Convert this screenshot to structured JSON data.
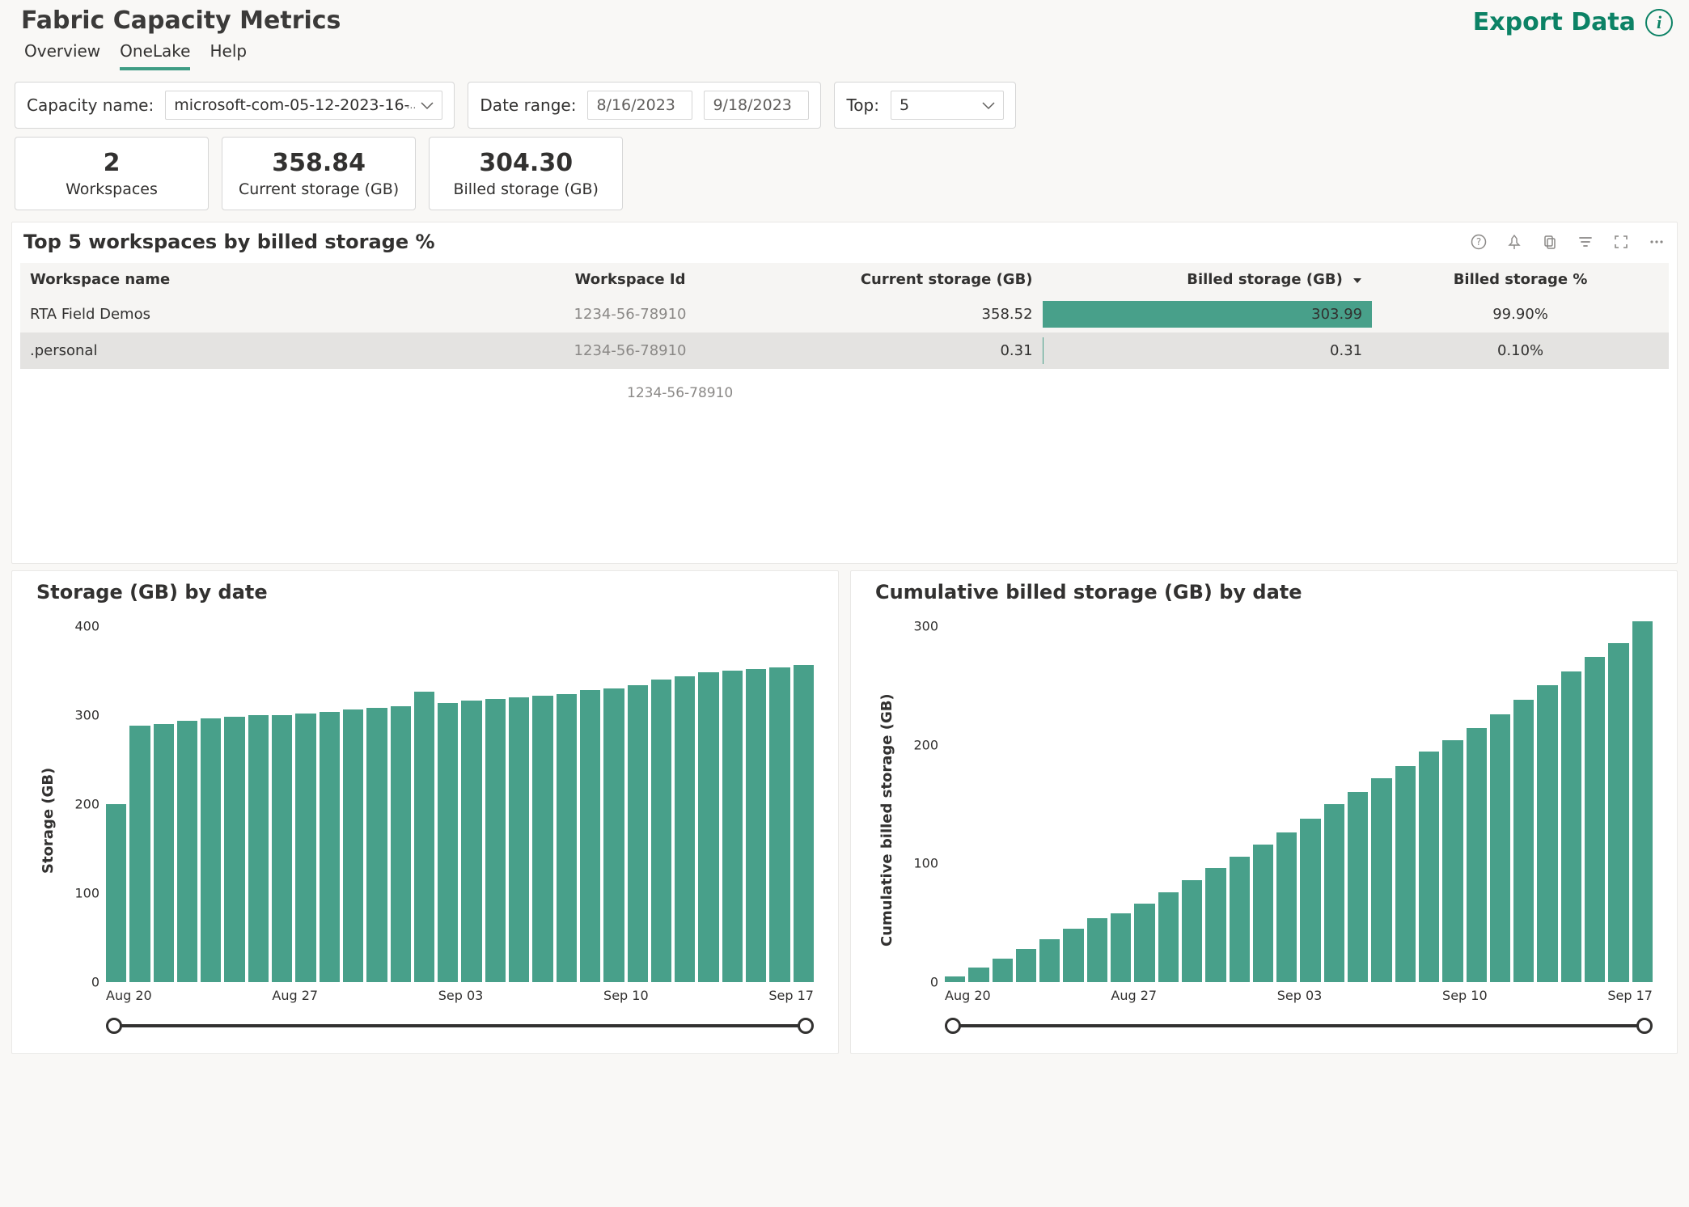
{
  "header": {
    "title": "Fabric Capacity Metrics",
    "tabs": [
      {
        "label": "Overview",
        "active": false
      },
      {
        "label": "OneLake",
        "active": true
      },
      {
        "label": "Help",
        "active": false
      }
    ],
    "export_label": "Export Data"
  },
  "filters": {
    "capacity_label": "Capacity name:",
    "capacity_value": "microsoft-com-05-12-2023-16-",
    "date_label": "Date range:",
    "date_start": "8/16/2023",
    "date_end": "9/18/2023",
    "top_label": "Top:",
    "top_value": "5"
  },
  "cards": [
    {
      "value": "2",
      "label": "Workspaces"
    },
    {
      "value": "358.84",
      "label": "Current storage (GB)"
    },
    {
      "value": "304.30",
      "label": "Billed storage (GB)"
    }
  ],
  "table": {
    "title": "Top 5 workspaces by billed storage %",
    "columns": {
      "workspace": "Workspace name",
      "workspace_id": "Workspace Id",
      "current": "Current storage (GB)",
      "billed": "Billed storage (GB)",
      "billed_pct": "Billed storage %"
    },
    "rows": [
      {
        "workspace": "RTA Field Demos",
        "workspace_id": "1234-56-78910",
        "current": "358.52",
        "billed": "303.99",
        "billed_frac": 1.0,
        "billed_pct": "99.90%"
      },
      {
        "workspace": ".personal",
        "workspace_id": "1234-56-78910",
        "current": "0.31",
        "billed": "0.31",
        "billed_frac": 0.001,
        "billed_pct": "0.10%"
      }
    ],
    "footer": "1234-56-78910"
  },
  "chart_data": [
    {
      "type": "bar",
      "title": "Storage (GB) by date",
      "ylabel": "Storage (GB)",
      "xlabel": "",
      "ylim": [
        0,
        400
      ],
      "y_ticks": [
        0,
        100,
        200,
        300,
        400
      ],
      "x_ticks": [
        "Aug 20",
        "Aug 27",
        "Sep 03",
        "Sep 10",
        "Sep 17"
      ],
      "categories": [
        "Aug 20",
        "Aug 21",
        "Aug 22",
        "Aug 23",
        "Aug 24",
        "Aug 25",
        "Aug 26",
        "Aug 27",
        "Aug 28",
        "Aug 29",
        "Aug 30",
        "Aug 31",
        "Sep 01",
        "Sep 02",
        "Sep 03",
        "Sep 04",
        "Sep 05",
        "Sep 06",
        "Sep 07",
        "Sep 08",
        "Sep 09",
        "Sep 10",
        "Sep 11",
        "Sep 12",
        "Sep 13",
        "Sep 14",
        "Sep 15",
        "Sep 16",
        "Sep 17",
        "Sep 18"
      ],
      "values": [
        200,
        288,
        290,
        294,
        296,
        298,
        300,
        300,
        302,
        304,
        306,
        308,
        310,
        326,
        314,
        316,
        318,
        320,
        322,
        324,
        328,
        330,
        334,
        340,
        344,
        348,
        350,
        352,
        354,
        356
      ]
    },
    {
      "type": "bar",
      "title": "Cumulative billed storage (GB) by date",
      "ylabel": "Cumulative billed storage (GB)",
      "xlabel": "",
      "ylim": [
        0,
        300
      ],
      "y_ticks": [
        0,
        100,
        200,
        300
      ],
      "x_ticks": [
        "Aug 20",
        "Aug 27",
        "Sep 03",
        "Sep 10",
        "Sep 17"
      ],
      "categories": [
        "Aug 20",
        "Aug 21",
        "Aug 22",
        "Aug 23",
        "Aug 24",
        "Aug 25",
        "Aug 26",
        "Aug 27",
        "Aug 28",
        "Aug 29",
        "Aug 30",
        "Aug 31",
        "Sep 01",
        "Sep 02",
        "Sep 03",
        "Sep 04",
        "Sep 05",
        "Sep 06",
        "Sep 07",
        "Sep 08",
        "Sep 09",
        "Sep 10",
        "Sep 11",
        "Sep 12",
        "Sep 13",
        "Sep 14",
        "Sep 15",
        "Sep 16",
        "Sep 17",
        "Sep 18"
      ],
      "values": [
        5,
        12,
        20,
        28,
        36,
        45,
        54,
        58,
        66,
        76,
        86,
        96,
        106,
        116,
        126,
        138,
        150,
        160,
        172,
        182,
        194,
        204,
        214,
        226,
        238,
        250,
        262,
        274,
        286,
        304
      ]
    }
  ]
}
